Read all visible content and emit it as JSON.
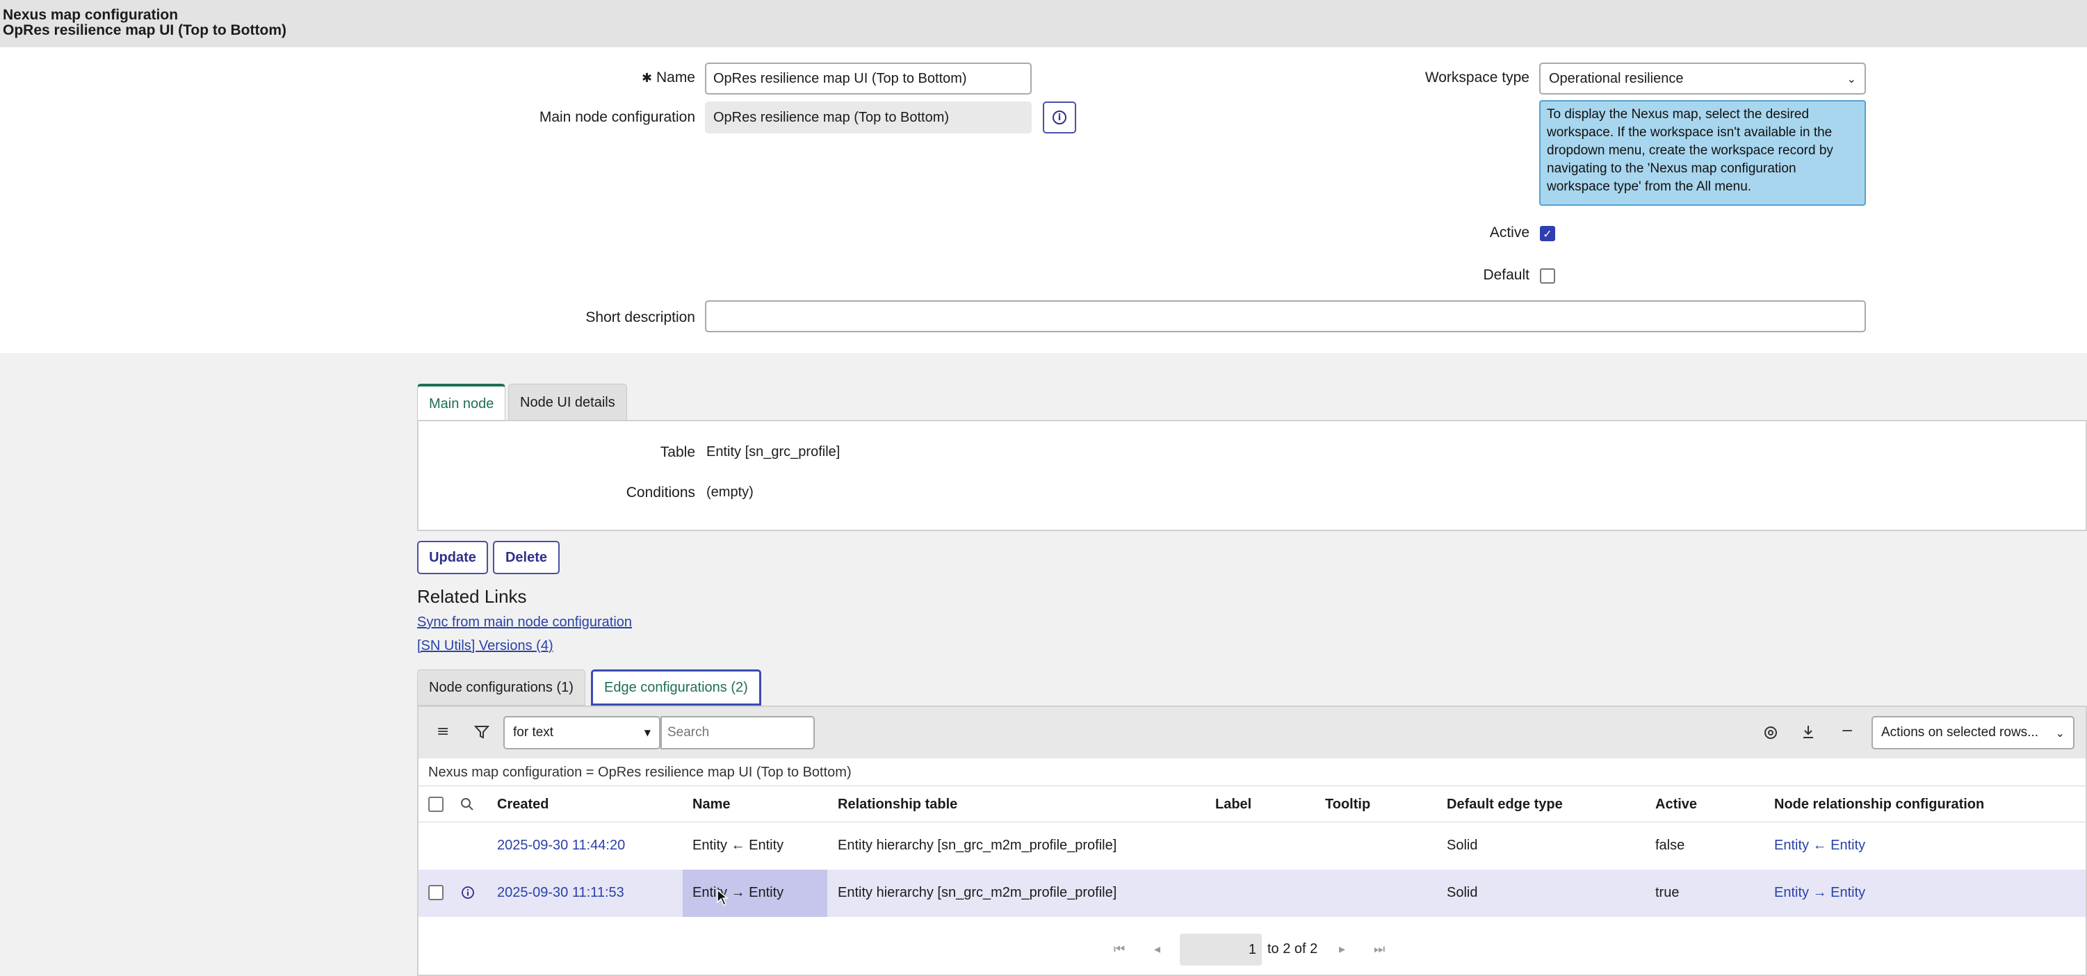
{
  "header": {
    "record_type": "Nexus map configuration",
    "record_name": "OpRes resilience map UI (Top to Bottom)"
  },
  "form": {
    "name_label": "Name",
    "required_mark": "✱",
    "name_value": "OpRes resilience map UI (Top to Bottom)",
    "main_node_label": "Main node configuration",
    "main_node_value": "OpRes resilience map (Top to Bottom)",
    "workspace_label": "Workspace type",
    "workspace_value": "Operational resilience",
    "workspace_tip": "To display the Nexus map, select the desired workspace. If the workspace isn't available in the dropdown menu, create the workspace record by navigating to the 'Nexus map configuration workspace type' from the All menu.",
    "active_label": "Active",
    "active_checked": true,
    "default_label": "Default",
    "default_checked": false,
    "short_desc_label": "Short description",
    "short_desc_value": ""
  },
  "section_tabs": [
    {
      "label": "Main node",
      "active": true
    },
    {
      "label": "Node UI details",
      "active": false
    }
  ],
  "main_node": {
    "table_label": "Table",
    "table_value": "Entity [sn_grc_profile]",
    "conditions_label": "Conditions",
    "conditions_value": "(empty)"
  },
  "buttons": {
    "update": "Update",
    "delete": "Delete"
  },
  "related_links": {
    "heading": "Related Links",
    "items": [
      "Sync from main node configuration",
      "[SN Utils] Versions (4)"
    ]
  },
  "related_tabs": [
    {
      "label": "Node configurations (1)",
      "selected": false
    },
    {
      "label": "Edge configurations (2)",
      "selected": true
    }
  ],
  "list": {
    "search_field": "for text",
    "search_placeholder": "Search",
    "actions_select": "Actions on selected rows...",
    "breadcrumb": "Nexus map configuration = OpRes resilience map UI (Top to Bottom)",
    "columns": [
      "Created",
      "Name",
      "Relationship table",
      "Label",
      "Tooltip",
      "Default edge type",
      "Active",
      "Node relationship configuration"
    ],
    "rows": [
      {
        "created": "2025-09-30 11:44:20",
        "name": "Entity ← Entity",
        "relationship_table": "Entity hierarchy [sn_grc_m2m_profile_profile]",
        "label": "",
        "tooltip": "",
        "default_edge_type": "Solid",
        "active": "false",
        "node_relationship": "Entity ← Entity"
      },
      {
        "created": "2025-09-30 11:11:53",
        "name": "Entity → Entity",
        "relationship_table": "Entity hierarchy [sn_grc_m2m_profile_profile]",
        "label": "",
        "tooltip": "",
        "default_edge_type": "Solid",
        "active": "true",
        "node_relationship": "Entity → Entity"
      }
    ],
    "pager": {
      "page_value": "1",
      "range_text": "to 2 of 2"
    }
  },
  "colors": {
    "accent": "#2d318a",
    "link": "#2a41a8",
    "tab_active": "#1e6f52",
    "tip_bg": "#a8d6ee"
  }
}
